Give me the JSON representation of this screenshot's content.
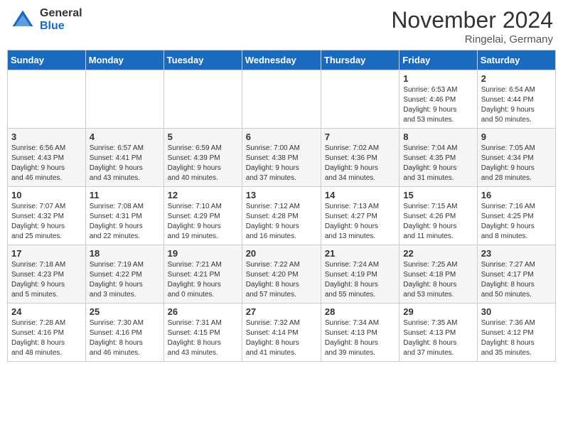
{
  "logo": {
    "general": "General",
    "blue": "Blue"
  },
  "title": "November 2024",
  "subtitle": "Ringelai, Germany",
  "days_of_week": [
    "Sunday",
    "Monday",
    "Tuesday",
    "Wednesday",
    "Thursday",
    "Friday",
    "Saturday"
  ],
  "weeks": [
    [
      {
        "day": "",
        "info": ""
      },
      {
        "day": "",
        "info": ""
      },
      {
        "day": "",
        "info": ""
      },
      {
        "day": "",
        "info": ""
      },
      {
        "day": "",
        "info": ""
      },
      {
        "day": "1",
        "info": "Sunrise: 6:53 AM\nSunset: 4:46 PM\nDaylight: 9 hours\nand 53 minutes."
      },
      {
        "day": "2",
        "info": "Sunrise: 6:54 AM\nSunset: 4:44 PM\nDaylight: 9 hours\nand 50 minutes."
      }
    ],
    [
      {
        "day": "3",
        "info": "Sunrise: 6:56 AM\nSunset: 4:43 PM\nDaylight: 9 hours\nand 46 minutes."
      },
      {
        "day": "4",
        "info": "Sunrise: 6:57 AM\nSunset: 4:41 PM\nDaylight: 9 hours\nand 43 minutes."
      },
      {
        "day": "5",
        "info": "Sunrise: 6:59 AM\nSunset: 4:39 PM\nDaylight: 9 hours\nand 40 minutes."
      },
      {
        "day": "6",
        "info": "Sunrise: 7:00 AM\nSunset: 4:38 PM\nDaylight: 9 hours\nand 37 minutes."
      },
      {
        "day": "7",
        "info": "Sunrise: 7:02 AM\nSunset: 4:36 PM\nDaylight: 9 hours\nand 34 minutes."
      },
      {
        "day": "8",
        "info": "Sunrise: 7:04 AM\nSunset: 4:35 PM\nDaylight: 9 hours\nand 31 minutes."
      },
      {
        "day": "9",
        "info": "Sunrise: 7:05 AM\nSunset: 4:34 PM\nDaylight: 9 hours\nand 28 minutes."
      }
    ],
    [
      {
        "day": "10",
        "info": "Sunrise: 7:07 AM\nSunset: 4:32 PM\nDaylight: 9 hours\nand 25 minutes."
      },
      {
        "day": "11",
        "info": "Sunrise: 7:08 AM\nSunset: 4:31 PM\nDaylight: 9 hours\nand 22 minutes."
      },
      {
        "day": "12",
        "info": "Sunrise: 7:10 AM\nSunset: 4:29 PM\nDaylight: 9 hours\nand 19 minutes."
      },
      {
        "day": "13",
        "info": "Sunrise: 7:12 AM\nSunset: 4:28 PM\nDaylight: 9 hours\nand 16 minutes."
      },
      {
        "day": "14",
        "info": "Sunrise: 7:13 AM\nSunset: 4:27 PM\nDaylight: 9 hours\nand 13 minutes."
      },
      {
        "day": "15",
        "info": "Sunrise: 7:15 AM\nSunset: 4:26 PM\nDaylight: 9 hours\nand 11 minutes."
      },
      {
        "day": "16",
        "info": "Sunrise: 7:16 AM\nSunset: 4:25 PM\nDaylight: 9 hours\nand 8 minutes."
      }
    ],
    [
      {
        "day": "17",
        "info": "Sunrise: 7:18 AM\nSunset: 4:23 PM\nDaylight: 9 hours\nand 5 minutes."
      },
      {
        "day": "18",
        "info": "Sunrise: 7:19 AM\nSunset: 4:22 PM\nDaylight: 9 hours\nand 3 minutes."
      },
      {
        "day": "19",
        "info": "Sunrise: 7:21 AM\nSunset: 4:21 PM\nDaylight: 9 hours\nand 0 minutes."
      },
      {
        "day": "20",
        "info": "Sunrise: 7:22 AM\nSunset: 4:20 PM\nDaylight: 8 hours\nand 57 minutes."
      },
      {
        "day": "21",
        "info": "Sunrise: 7:24 AM\nSunset: 4:19 PM\nDaylight: 8 hours\nand 55 minutes."
      },
      {
        "day": "22",
        "info": "Sunrise: 7:25 AM\nSunset: 4:18 PM\nDaylight: 8 hours\nand 53 minutes."
      },
      {
        "day": "23",
        "info": "Sunrise: 7:27 AM\nSunset: 4:17 PM\nDaylight: 8 hours\nand 50 minutes."
      }
    ],
    [
      {
        "day": "24",
        "info": "Sunrise: 7:28 AM\nSunset: 4:16 PM\nDaylight: 8 hours\nand 48 minutes."
      },
      {
        "day": "25",
        "info": "Sunrise: 7:30 AM\nSunset: 4:16 PM\nDaylight: 8 hours\nand 46 minutes."
      },
      {
        "day": "26",
        "info": "Sunrise: 7:31 AM\nSunset: 4:15 PM\nDaylight: 8 hours\nand 43 minutes."
      },
      {
        "day": "27",
        "info": "Sunrise: 7:32 AM\nSunset: 4:14 PM\nDaylight: 8 hours\nand 41 minutes."
      },
      {
        "day": "28",
        "info": "Sunrise: 7:34 AM\nSunset: 4:13 PM\nDaylight: 8 hours\nand 39 minutes."
      },
      {
        "day": "29",
        "info": "Sunrise: 7:35 AM\nSunset: 4:13 PM\nDaylight: 8 hours\nand 37 minutes."
      },
      {
        "day": "30",
        "info": "Sunrise: 7:36 AM\nSunset: 4:12 PM\nDaylight: 8 hours\nand 35 minutes."
      }
    ]
  ]
}
